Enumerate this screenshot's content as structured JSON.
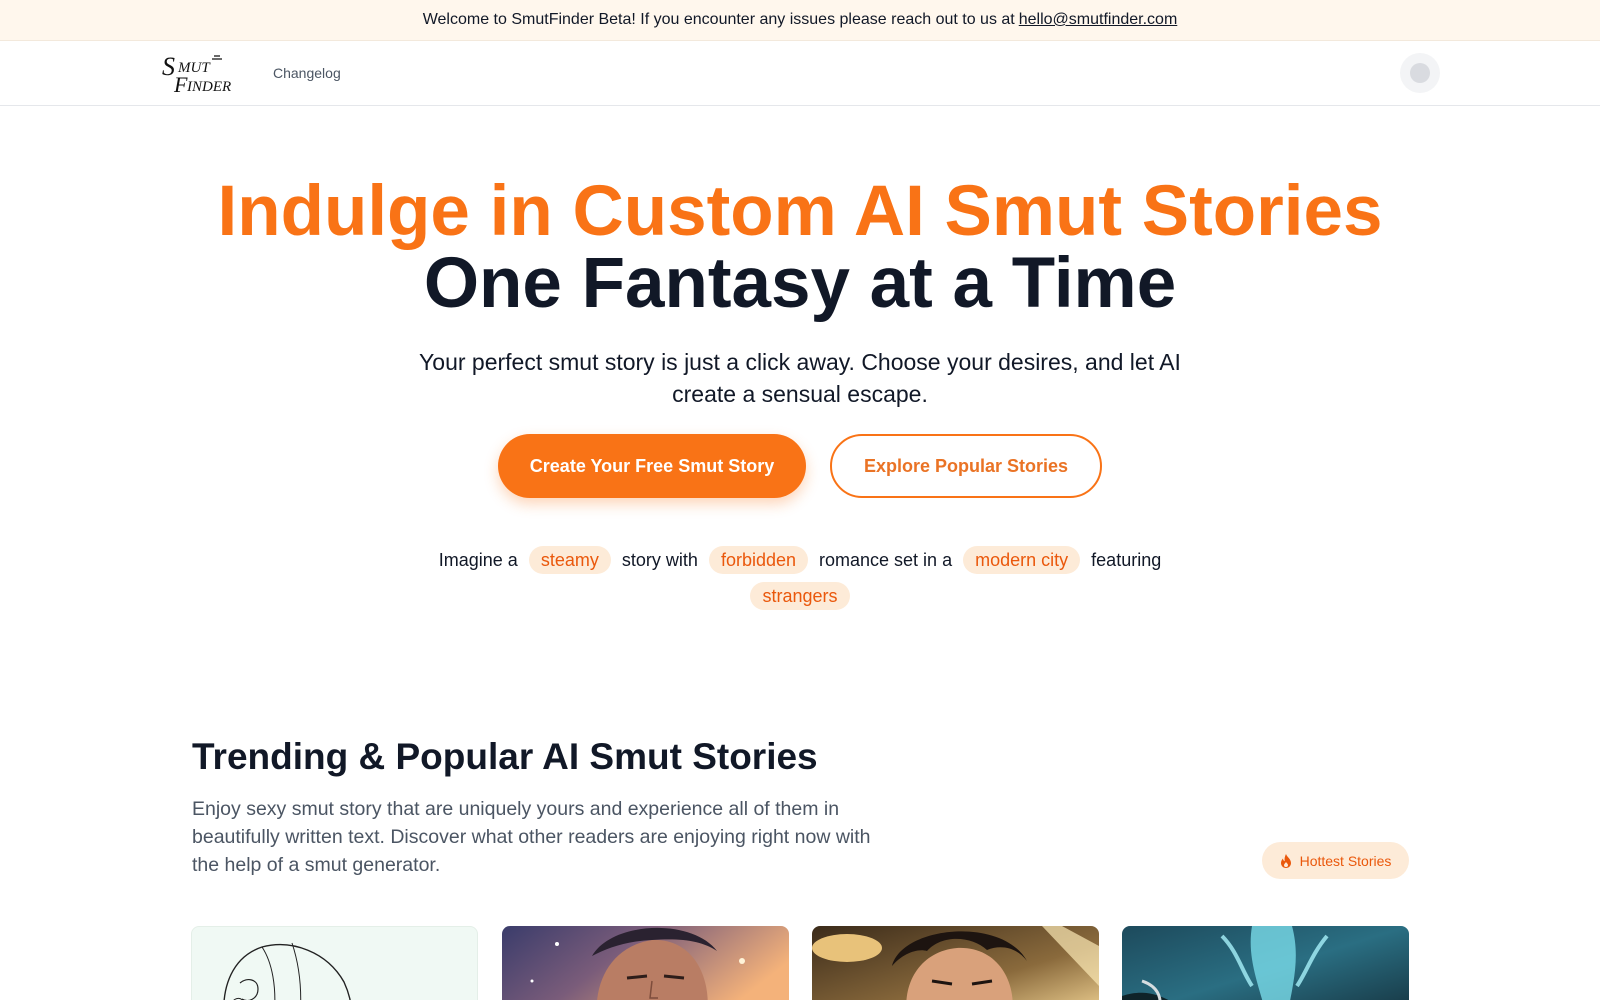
{
  "banner": {
    "text": "Welcome to SmutFinder Beta! If you encounter any issues please reach out to us at",
    "email": "hello@smutfinder.com"
  },
  "nav": {
    "logo_text": "SmutFinder",
    "links": [
      {
        "label": "Changelog"
      }
    ]
  },
  "hero": {
    "title_line1": "Indulge in Custom AI Smut Stories",
    "title_line2": "One Fantasy at a Time",
    "subtitle": "Your perfect smut story is just a click away. Choose your desires, and let AI create a sensual escape.",
    "primary_cta": "Create Your Free Smut Story",
    "secondary_cta": "Explore Popular Stories",
    "prompt": {
      "w1": "Imagine a",
      "c1": "steamy",
      "w2": "story with",
      "c2": "forbidden",
      "w3": "romance set in a",
      "c3": "modern city",
      "w4": "featuring",
      "c4": "strangers"
    }
  },
  "trending": {
    "title": "Trending & Popular AI Smut Stories",
    "description": "Enjoy sexy smut story that are uniquely yours and experience all of them in beautifully written text. Discover what other readers are enjoying right now with the help of a smut generator.",
    "filter_label": "Hottest Stories"
  },
  "colors": {
    "accent": "#f97316",
    "banner_bg": "#fff7ed",
    "chip_bg": "#fdebd8",
    "heading": "#111827"
  },
  "icons": [
    "fire-icon",
    "avatar-icon"
  ]
}
